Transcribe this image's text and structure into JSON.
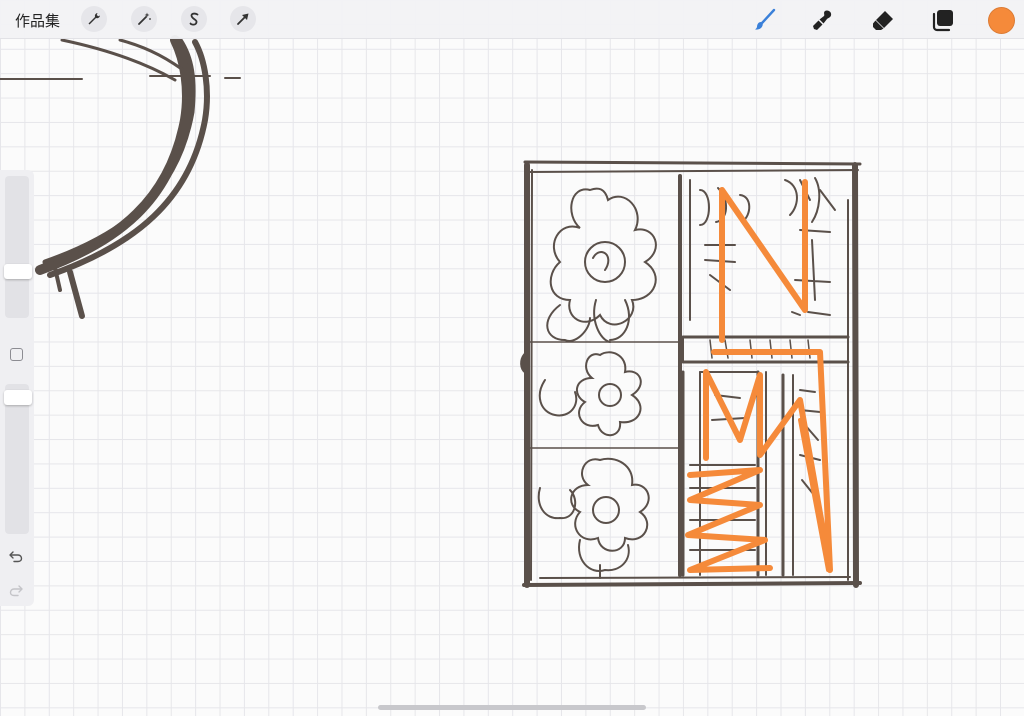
{
  "toolbar": {
    "gallery_label": "作品集",
    "left_tools": [
      {
        "name": "wrench-icon"
      },
      {
        "name": "magic-wand-icon"
      },
      {
        "name": "selection-s-icon"
      },
      {
        "name": "transform-arrow-icon"
      }
    ],
    "right_tools": [
      {
        "name": "brush-icon"
      },
      {
        "name": "smudge-icon"
      },
      {
        "name": "eraser-icon"
      },
      {
        "name": "layers-icon"
      }
    ],
    "active_color": "#f58a3a",
    "brush_color": "#3a80d9"
  },
  "sidebar": {
    "brush_size_level": 0.31,
    "opacity_level": 0.06,
    "undo_icon": "undo-icon",
    "redo_icon": "redo-icon"
  },
  "canvas": {
    "ink_color": "#5a504a",
    "accent_color": "#f58a3a"
  }
}
